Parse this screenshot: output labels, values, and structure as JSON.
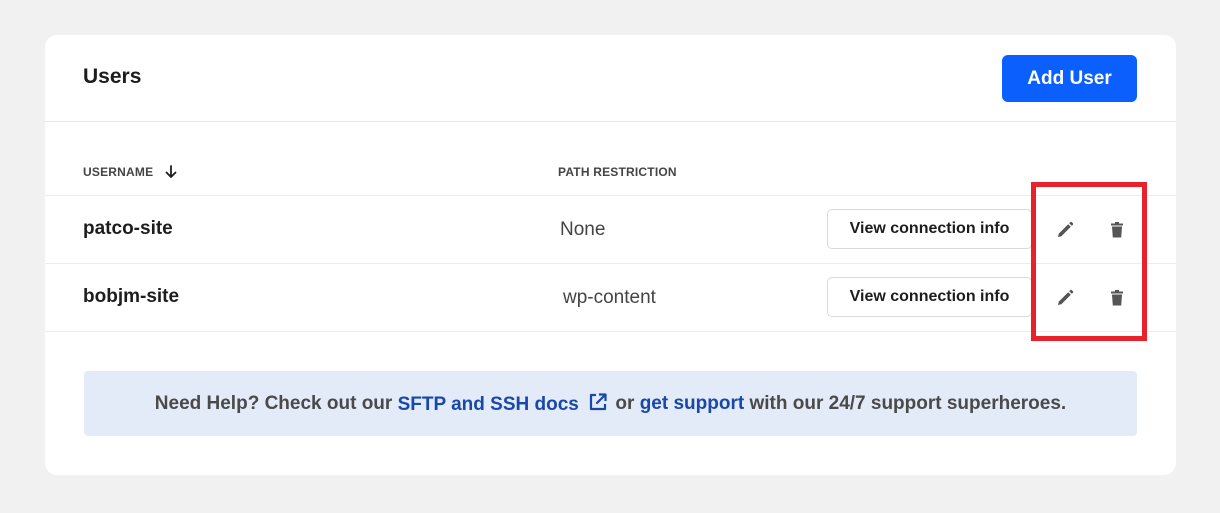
{
  "header": {
    "title": "Users",
    "add_button_label": "Add User"
  },
  "table": {
    "columns": {
      "username": "USERNAME",
      "path": "PATH RESTRICTION"
    },
    "rows": [
      {
        "username": "patco-site",
        "path": "None",
        "action_label": "View connection info"
      },
      {
        "username": "bobjm-site",
        "path": "wp-content",
        "action_label": "View connection info"
      }
    ]
  },
  "help": {
    "prefix": "Need Help? Check out our ",
    "docs_link": "SFTP and SSH docs",
    "middle": " or ",
    "support_link": "get support",
    "suffix": " with our 24/7 support superheroes."
  },
  "icons": {
    "sort": "arrow-down-icon",
    "edit": "pencil-icon",
    "delete": "trash-icon",
    "external": "external-link-icon"
  },
  "colors": {
    "primary": "#0a5ffd",
    "link": "#1848a8",
    "help_bg": "#e3eaf8",
    "highlight": "#e8212b"
  }
}
